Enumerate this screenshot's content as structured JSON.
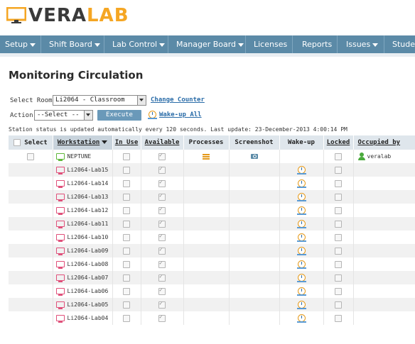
{
  "logo": {
    "text_a": "VERA",
    "text_b": "LAB",
    "icon": "monitor-logo-icon"
  },
  "nav": [
    {
      "label": "Setup",
      "dropdown": true
    },
    {
      "label": "Shift Board",
      "dropdown": true
    },
    {
      "label": "Lab Control",
      "dropdown": true
    },
    {
      "label": "Manager Board",
      "dropdown": true
    },
    {
      "label": "Licenses",
      "dropdown": false
    },
    {
      "label": "Reports",
      "dropdown": false
    },
    {
      "label": "Issues",
      "dropdown": true
    },
    {
      "label": "Studen",
      "dropdown": false
    }
  ],
  "page": {
    "title": "Monitoring Circulation",
    "select_room_label": "Select Room",
    "room_value": "Li2064 - Classroom",
    "change_counter": "Change Counter",
    "action_label": "Action",
    "action_value": "--Select --",
    "execute": "Execute",
    "wake_up_all": "Wake-up All",
    "status": "Station status is updated automatically every 120 seconds. Last update: 23-December-2013 4:00:14 PM"
  },
  "table": {
    "headers": {
      "select": "Select",
      "workstation": "Workstation",
      "in_use": "In Use",
      "available": "Available",
      "processes": "Processes",
      "screenshot": "Screenshot",
      "wake_up": "Wake-up",
      "locked": "Locked",
      "occupied_by": "Occupied by"
    },
    "rows": [
      {
        "name": "NEPTUNE",
        "status": "online",
        "in_use": false,
        "available": true,
        "has_processes": true,
        "has_screenshot": true,
        "wake_up": false,
        "locked": false,
        "occupied_by": "veralab",
        "selectable": true
      },
      {
        "name": "Li2064-Lab15",
        "status": "offline",
        "in_use": false,
        "available": true,
        "wake_up": true,
        "locked": false,
        "occupied_by": ""
      },
      {
        "name": "Li2064-Lab14",
        "status": "offline",
        "in_use": false,
        "available": true,
        "wake_up": true,
        "locked": false,
        "occupied_by": ""
      },
      {
        "name": "Li2064-Lab13",
        "status": "offline",
        "in_use": false,
        "available": true,
        "wake_up": true,
        "locked": false,
        "occupied_by": ""
      },
      {
        "name": "Li2064-Lab12",
        "status": "offline",
        "in_use": false,
        "available": true,
        "wake_up": true,
        "locked": false,
        "occupied_by": ""
      },
      {
        "name": "Li2064-Lab11",
        "status": "offline",
        "in_use": false,
        "available": true,
        "wake_up": true,
        "locked": false,
        "occupied_by": ""
      },
      {
        "name": "Li2064-Lab10",
        "status": "offline",
        "in_use": false,
        "available": true,
        "wake_up": true,
        "locked": false,
        "occupied_by": ""
      },
      {
        "name": "Li2064-Lab09",
        "status": "offline",
        "in_use": false,
        "available": true,
        "wake_up": true,
        "locked": false,
        "occupied_by": ""
      },
      {
        "name": "Li2064-Lab08",
        "status": "offline",
        "in_use": false,
        "available": true,
        "wake_up": true,
        "locked": false,
        "occupied_by": ""
      },
      {
        "name": "Li2064-Lab07",
        "status": "offline",
        "in_use": false,
        "available": true,
        "wake_up": true,
        "locked": false,
        "occupied_by": ""
      },
      {
        "name": "Li2064-Lab06",
        "status": "offline",
        "in_use": false,
        "available": true,
        "wake_up": true,
        "locked": false,
        "occupied_by": ""
      },
      {
        "name": "Li2064-Lab05",
        "status": "offline",
        "in_use": false,
        "available": true,
        "wake_up": true,
        "locked": false,
        "occupied_by": ""
      },
      {
        "name": "Li2064-Lab04",
        "status": "offline",
        "in_use": false,
        "available": true,
        "wake_up": true,
        "locked": false,
        "occupied_by": ""
      }
    ]
  },
  "colors": {
    "nav": "#5b8aa7",
    "accent": "#f5a623",
    "link": "#2a6ca8",
    "online": "#5fb83a",
    "offline": "#e0507a"
  }
}
